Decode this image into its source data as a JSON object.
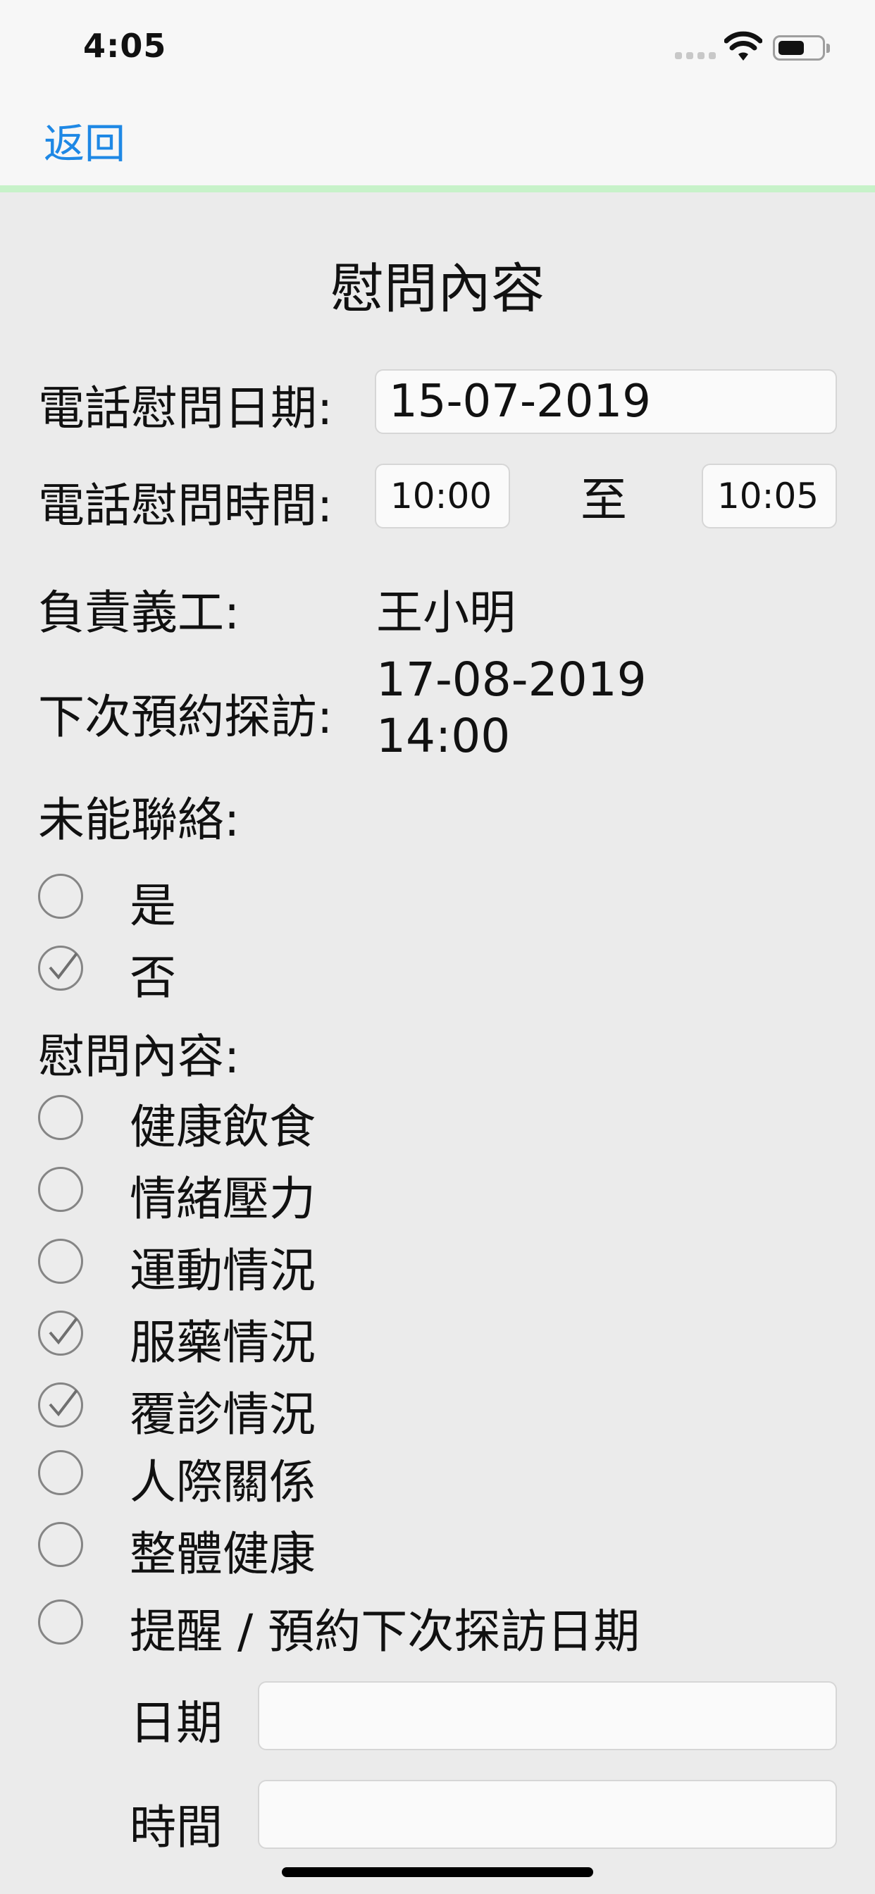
{
  "status_bar": {
    "time": "4:05"
  },
  "nav": {
    "back_label": "返回"
  },
  "page": {
    "title": "慰問內容"
  },
  "form": {
    "call_date_label": "電話慰問日期:",
    "call_date_value": "15-07-2019",
    "call_time_label": "電話慰問時間:",
    "call_time_from": "10:00",
    "call_time_to_label": "至",
    "call_time_to": "10:05",
    "volunteer_label": "負責義工:",
    "volunteer_value": "王小明",
    "next_visit_label": "下次預約探訪:",
    "next_visit_date": "17-08-2019",
    "next_visit_time": "14:00",
    "unreachable_label": "未能聯絡:",
    "unreachable_options": [
      {
        "label": "是",
        "checked": false
      },
      {
        "label": "否",
        "checked": true
      }
    ],
    "content_label": "慰問內容:",
    "content_options": [
      {
        "label": "健康飲食",
        "checked": false
      },
      {
        "label": "情緒壓力",
        "checked": false
      },
      {
        "label": "運動情況",
        "checked": false
      },
      {
        "label": "服藥情況",
        "checked": true
      },
      {
        "label": "覆診情況",
        "checked": true
      },
      {
        "label": "人際關係",
        "checked": false
      },
      {
        "label": "整體健康",
        "checked": false
      },
      {
        "label": "提醒 / 預約下次探訪日期",
        "checked": false
      }
    ],
    "reminder_date_label": "日期",
    "reminder_date_value": "",
    "reminder_time_label": "時間",
    "reminder_time_value": ""
  },
  "colors": {
    "accent": "#1e88e5",
    "nav_divider": "#c7f2c9",
    "background": "#ebebeb"
  }
}
